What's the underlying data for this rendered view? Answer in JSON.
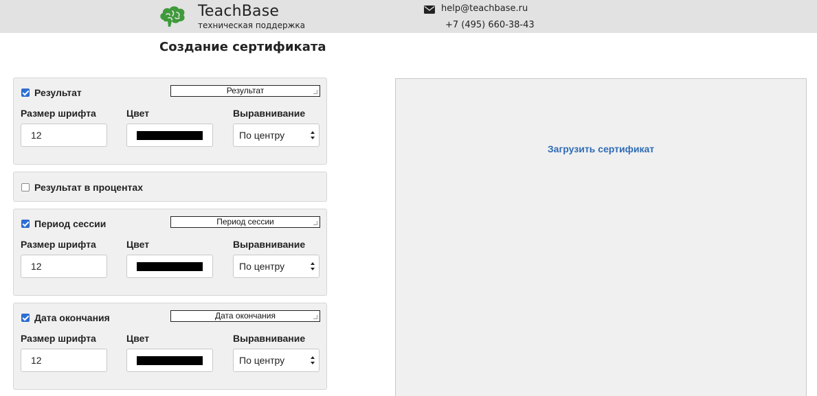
{
  "header": {
    "brand_name": "TeachBase",
    "brand_subtitle": "техническая поддержка",
    "logo_icon": "brain-icon",
    "brand_color": "#3e9a3a",
    "mail_icon": "envelope-icon",
    "email": "help@teachbase.ru",
    "phone": "+7 (495) 660-38-43"
  },
  "page_title": "Создание сертификата",
  "panels": [
    {
      "label": "Результат",
      "checked": true,
      "preview_text": "Результат",
      "font_size_label": "Размер шрифта",
      "font_size_value": "12",
      "color_label": "Цвет",
      "color_value": "#000000",
      "align_label": "Выравнивание",
      "align_value": "По центру"
    },
    {
      "label": "Результат в процентах",
      "checked": false
    },
    {
      "label": "Период сессии",
      "checked": true,
      "preview_text": "Период сессии",
      "font_size_label": "Размер шрифта",
      "font_size_value": "12",
      "color_label": "Цвет",
      "color_value": "#000000",
      "align_label": "Выравнивание",
      "align_value": "По центру"
    },
    {
      "label": "Дата окончания",
      "checked": true,
      "preview_text": "Дата окончания",
      "font_size_label": "Размер шрифта",
      "font_size_value": "12",
      "color_label": "Цвет",
      "color_value": "#000000",
      "align_label": "Выравнивание",
      "align_value": "По центру"
    }
  ],
  "upload": {
    "link_label": "Загрузить сертификат",
    "link_color": "#2e6bb5"
  }
}
